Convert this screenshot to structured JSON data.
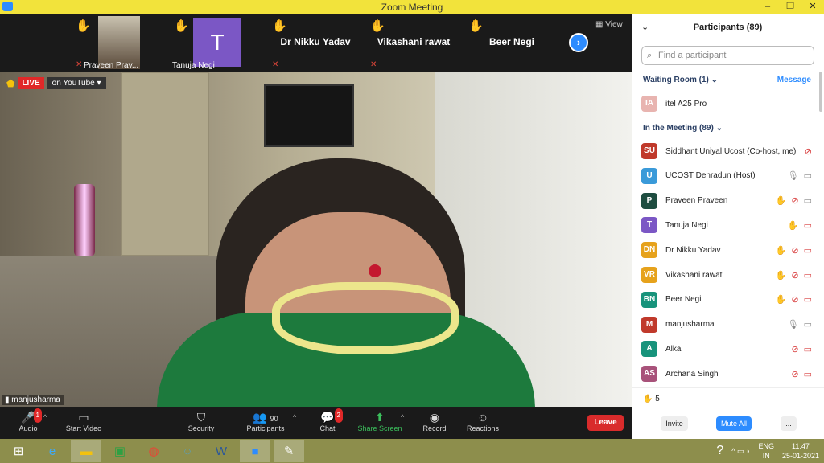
{
  "window": {
    "title": "Zoom Meeting",
    "controls": [
      "–",
      "❐",
      "✕"
    ]
  },
  "thumbnails": [
    {
      "name": "Praveen Prav...",
      "type": "video"
    },
    {
      "name": "Tanuja Negi",
      "type": "avatar",
      "initial": "T"
    },
    {
      "name": "Dr Nikku Yadav",
      "type": "name"
    },
    {
      "name": "Vikashani rawat",
      "type": "name"
    },
    {
      "name": "Beer Negi",
      "type": "name"
    }
  ],
  "view_label": "View",
  "live": {
    "badge": "LIVE",
    "platform": "on YouTube"
  },
  "speaker_name": "manjusharma",
  "toolbar": {
    "audio": "Audio",
    "audio_badge": "1",
    "start_video": "Start Video",
    "security": "Security",
    "participants": "Participants",
    "participants_count": "90",
    "chat": "Chat",
    "chat_badge": "2",
    "share_screen": "Share Screen",
    "record": "Record",
    "reactions": "Reactions",
    "leave": "Leave"
  },
  "panel": {
    "title": "Participants (89)",
    "search_placeholder": "Find a participant",
    "waiting_room": "Waiting Room (1)",
    "message": "Message",
    "waiting": [
      {
        "initials": "IA",
        "name": "itel A25 Pro",
        "color": "#e8b4b0"
      }
    ],
    "in_meeting": "In the Meeting (89)",
    "participants": [
      {
        "initials": "SU",
        "name": "Siddhant Uniyal Ucost (Co-host, me)",
        "color": "#c0392b",
        "hand": false,
        "mic": "muted",
        "video": "none"
      },
      {
        "initials": "U",
        "name": "UCOST Dehradun (Host)",
        "color": "#3a9ad9",
        "hand": false,
        "mic": "on",
        "video": "on"
      },
      {
        "initials": "P",
        "name": "Praveen Praveen",
        "color": "#1e4d40",
        "hand": true,
        "mic": "muted",
        "video": "on"
      },
      {
        "initials": "T",
        "name": "Tanuja Negi",
        "color": "#7b57c5",
        "hand": true,
        "mic": "none",
        "video": "off"
      },
      {
        "initials": "DN",
        "name": "Dr Nikku Yadav",
        "color": "#e6a21c",
        "hand": true,
        "mic": "muted",
        "video": "off"
      },
      {
        "initials": "VR",
        "name": "Vikashani rawat",
        "color": "#e6a21c",
        "hand": true,
        "mic": "muted",
        "video": "off"
      },
      {
        "initials": "BN",
        "name": "Beer Negi",
        "color": "#17937b",
        "hand": true,
        "mic": "muted",
        "video": "off"
      },
      {
        "initials": "M",
        "name": "manjusharma",
        "color": "#c0392b",
        "hand": false,
        "mic": "on",
        "video": "on"
      },
      {
        "initials": "A",
        "name": "Alka",
        "color": "#17937b",
        "hand": false,
        "mic": "muted",
        "video": "off"
      },
      {
        "initials": "AS",
        "name": "Archana Singh",
        "color": "#a8527a",
        "hand": false,
        "mic": "muted",
        "video": "off"
      }
    ],
    "raised_hands": "5",
    "invite": "Invite",
    "mute_all": "Mute All",
    "more": "..."
  },
  "taskbar": {
    "lang_top": "ENG",
    "lang_bottom": "IN",
    "time": "11:47",
    "date": "25-01-2021"
  }
}
